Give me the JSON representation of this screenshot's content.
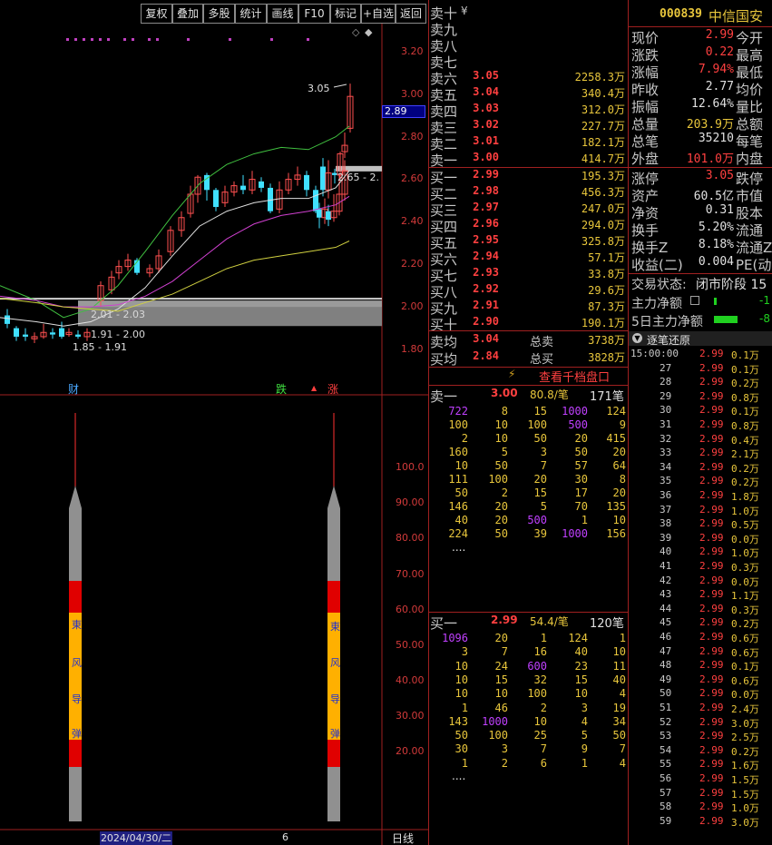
{
  "toolbar": {
    "buttons": [
      "复权",
      "叠加",
      "多股",
      "统计",
      "画线",
      "F10",
      "标记",
      "+自选",
      "返回"
    ]
  },
  "kline": {
    "price_axis": [
      "3.20",
      "3.00",
      "2.80",
      "2.60",
      "2.40",
      "2.20",
      "2.00",
      "1.80"
    ],
    "current_price_tag": "2.89",
    "annot_high": "3.05",
    "annot_box": "2.65 - 2.",
    "zone1": "2.01 - 2.03",
    "zone2": "1.91 - 2.00",
    "zone3": "1.85 - 1.91",
    "markers": [
      "财",
      "跌",
      "涨"
    ]
  },
  "indicator": {
    "axis": [
      "100.0",
      "90.00",
      "80.00",
      "70.00",
      "60.00",
      "50.00",
      "40.00",
      "30.00",
      "20.00"
    ],
    "rocket_text": [
      "東",
      "风",
      "导",
      "弹"
    ]
  },
  "footer": {
    "date": "2024/04/30/二",
    "num": "6",
    "period": "日线"
  },
  "orderbook": {
    "yen": "¥",
    "sells": [
      {
        "label": "卖十",
        "price": "",
        "vol": ""
      },
      {
        "label": "卖九",
        "price": "",
        "vol": ""
      },
      {
        "label": "卖八",
        "price": "",
        "vol": ""
      },
      {
        "label": "卖七",
        "price": "",
        "vol": ""
      },
      {
        "label": "卖六",
        "price": "3.05",
        "vol": "2258.3万"
      },
      {
        "label": "卖五",
        "price": "3.04",
        "vol": "340.4万"
      },
      {
        "label": "卖四",
        "price": "3.03",
        "vol": "312.0万"
      },
      {
        "label": "卖三",
        "price": "3.02",
        "vol": "227.7万"
      },
      {
        "label": "卖二",
        "price": "3.01",
        "vol": "182.1万"
      },
      {
        "label": "卖一",
        "price": "3.00",
        "vol": "414.7万"
      }
    ],
    "buys": [
      {
        "label": "买一",
        "price": "2.99",
        "vol": "195.3万"
      },
      {
        "label": "买二",
        "price": "2.98",
        "vol": "456.3万"
      },
      {
        "label": "买三",
        "price": "2.97",
        "vol": "247.0万"
      },
      {
        "label": "买四",
        "price": "2.96",
        "vol": "294.0万"
      },
      {
        "label": "买五",
        "price": "2.95",
        "vol": "325.8万"
      },
      {
        "label": "买六",
        "price": "2.94",
        "vol": "57.1万"
      },
      {
        "label": "买七",
        "price": "2.93",
        "vol": "33.8万"
      },
      {
        "label": "买八",
        "price": "2.92",
        "vol": "29.6万"
      },
      {
        "label": "买九",
        "price": "2.91",
        "vol": "87.3万"
      },
      {
        "label": "买十",
        "price": "2.90",
        "vol": "190.1万"
      }
    ],
    "avg_sell": {
      "label": "卖均",
      "price": "3.04",
      "tlabel": "总卖",
      "vol": "3738万"
    },
    "avg_buy": {
      "label": "买均",
      "price": "2.84",
      "tlabel": "总买",
      "vol": "3828万"
    },
    "view_queue": "查看千档盘口",
    "sell_queue": {
      "label": "卖一",
      "price": "3.00",
      "per": "80.8/笔",
      "count": "171笔",
      "rows": [
        [
          "722",
          "8",
          "15",
          "1000",
          "124"
        ],
        [
          "100",
          "10",
          "100",
          "500",
          "9"
        ],
        [
          "2",
          "10",
          "50",
          "20",
          "415"
        ],
        [
          "160",
          "5",
          "3",
          "50",
          "20"
        ],
        [
          "10",
          "50",
          "7",
          "57",
          "64"
        ],
        [
          "111",
          "100",
          "20",
          "30",
          "8"
        ],
        [
          "50",
          "2",
          "15",
          "17",
          "20"
        ],
        [
          "146",
          "20",
          "5",
          "70",
          "135"
        ],
        [
          "40",
          "20",
          "500",
          "1",
          "10"
        ],
        [
          "224",
          "50",
          "39",
          "1000",
          "156"
        ]
      ],
      "more": "...."
    },
    "buy_queue": {
      "label": "买一",
      "price": "2.99",
      "per": "54.4/笔",
      "count": "120笔",
      "rows": [
        [
          "1096",
          "20",
          "1",
          "124",
          "1"
        ],
        [
          "3",
          "7",
          "16",
          "40",
          "10"
        ],
        [
          "10",
          "24",
          "600",
          "23",
          "11"
        ],
        [
          "10",
          "15",
          "32",
          "15",
          "40"
        ],
        [
          "10",
          "10",
          "100",
          "10",
          "4"
        ],
        [
          "1",
          "46",
          "2",
          "3",
          "19"
        ],
        [
          "143",
          "1000",
          "10",
          "4",
          "34"
        ],
        [
          "50",
          "100",
          "25",
          "5",
          "50"
        ],
        [
          "30",
          "3",
          "7",
          "9",
          "7"
        ],
        [
          "1",
          "2",
          "6",
          "1",
          "4"
        ]
      ],
      "more": "...."
    }
  },
  "quote": {
    "code": "000839",
    "name": "中信国安",
    "rows": [
      {
        "l1": "现价",
        "v1": "2.99",
        "c": "#ff4040",
        "l2": "今开"
      },
      {
        "l1": "涨跌",
        "v1": "0.22",
        "c": "#ff4040",
        "l2": "最高"
      },
      {
        "l1": "涨幅",
        "v1": "7.94%",
        "c": "#ff4040",
        "l2": "最低"
      },
      {
        "l1": "昨收",
        "v1": "2.77",
        "c": "#e0e0e0",
        "l2": "均价"
      },
      {
        "l1": "振幅",
        "v1": "12.64%",
        "c": "#e0e0e0",
        "l2": "量比"
      },
      {
        "l1": "总量",
        "v1": "203.9万",
        "c": "#e8c63c",
        "l2": "总额"
      },
      {
        "l1": "总笔",
        "v1": "35210",
        "c": "#e0e0e0",
        "l2": "每笔"
      },
      {
        "l1": "外盘",
        "v1": "101.0万",
        "c": "#ff4040",
        "l2": "内盘"
      }
    ],
    "rows2": [
      {
        "l1": "涨停",
        "v1": "3.05",
        "c": "#ff4040",
        "l2": "跌停"
      },
      {
        "l1": "资产",
        "v1": "60.5亿",
        "c": "#e0e0e0",
        "l2": "市值"
      },
      {
        "l1": "净资",
        "v1": "0.31",
        "c": "#e0e0e0",
        "l2": "股本"
      },
      {
        "l1": "换手",
        "v1": "5.20%",
        "c": "#e0e0e0",
        "l2": "流通"
      },
      {
        "l1": "换手Z",
        "v1": "8.18%",
        "c": "#e0e0e0",
        "l2": "流通Z"
      },
      {
        "l1": "收益(二)",
        "v1": "0.004",
        "c": "#e0e0e0",
        "l2": "PE(动)"
      }
    ],
    "trade_status_label": "交易状态:",
    "trade_status": "闭市阶段 15",
    "main_net": "主力净额",
    "main_net_val": "-1",
    "main_net5": "5日主力净额",
    "main_net5_val": "-8",
    "ticks_title": "逐笔还原",
    "ticks": [
      {
        "t": "15:00:00",
        "p": "2.99",
        "v": "0.1万"
      },
      {
        "t": "27",
        "p": "2.99",
        "v": "0.1万"
      },
      {
        "t": "28",
        "p": "2.99",
        "v": "0.2万"
      },
      {
        "t": "29",
        "p": "2.99",
        "v": "0.8万"
      },
      {
        "t": "30",
        "p": "2.99",
        "v": "0.1万"
      },
      {
        "t": "31",
        "p": "2.99",
        "v": "0.8万"
      },
      {
        "t": "32",
        "p": "2.99",
        "v": "0.4万"
      },
      {
        "t": "33",
        "p": "2.99",
        "v": "2.1万"
      },
      {
        "t": "34",
        "p": "2.99",
        "v": "0.2万"
      },
      {
        "t": "35",
        "p": "2.99",
        "v": "0.2万"
      },
      {
        "t": "36",
        "p": "2.99",
        "v": "1.8万"
      },
      {
        "t": "37",
        "p": "2.99",
        "v": "1.0万"
      },
      {
        "t": "38",
        "p": "2.99",
        "v": "0.5万"
      },
      {
        "t": "39",
        "p": "2.99",
        "v": "0.0万"
      },
      {
        "t": "40",
        "p": "2.99",
        "v": "1.0万"
      },
      {
        "t": "41",
        "p": "2.99",
        "v": "0.3万"
      },
      {
        "t": "42",
        "p": "2.99",
        "v": "0.0万"
      },
      {
        "t": "43",
        "p": "2.99",
        "v": "1.1万"
      },
      {
        "t": "44",
        "p": "2.99",
        "v": "0.3万"
      },
      {
        "t": "45",
        "p": "2.99",
        "v": "0.2万"
      },
      {
        "t": "46",
        "p": "2.99",
        "v": "0.6万"
      },
      {
        "t": "47",
        "p": "2.99",
        "v": "0.6万"
      },
      {
        "t": "48",
        "p": "2.99",
        "v": "0.1万"
      },
      {
        "t": "49",
        "p": "2.99",
        "v": "0.6万"
      },
      {
        "t": "50",
        "p": "2.99",
        "v": "0.0万"
      },
      {
        "t": "51",
        "p": "2.99",
        "v": "2.4万"
      },
      {
        "t": "52",
        "p": "2.99",
        "v": "3.0万"
      },
      {
        "t": "53",
        "p": "2.99",
        "v": "2.5万"
      },
      {
        "t": "54",
        "p": "2.99",
        "v": "0.2万"
      },
      {
        "t": "55",
        "p": "2.99",
        "v": "1.6万"
      },
      {
        "t": "56",
        "p": "2.99",
        "v": "1.5万"
      },
      {
        "t": "57",
        "p": "2.99",
        "v": "1.5万"
      },
      {
        "t": "58",
        "p": "2.99",
        "v": "1.0万"
      },
      {
        "t": "59",
        "p": "2.99",
        "v": "3.0万"
      }
    ]
  }
}
